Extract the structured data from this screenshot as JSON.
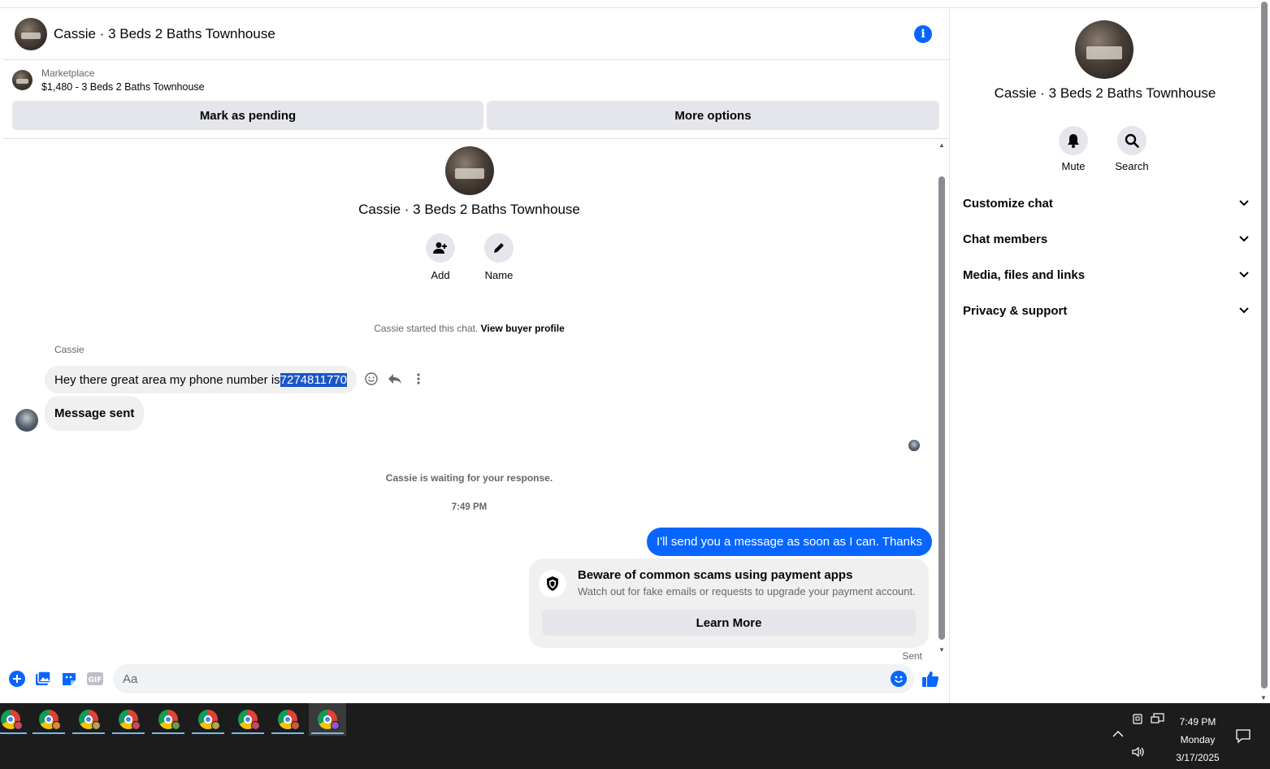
{
  "header": {
    "title": "Cassie · 3 Beds 2 Baths Townhouse",
    "info_icon": "info-icon"
  },
  "marketplace": {
    "label": "Marketplace",
    "listing": "$1,480 - 3 Beds 2 Baths Townhouse",
    "mark_pending": "Mark as pending",
    "more_options": "More options"
  },
  "conversation": {
    "name": "Cassie · 3 Beds 2 Baths Townhouse",
    "add_label": "Add",
    "name_label": "Name",
    "started_text": "Cassie started this chat.",
    "buyer_profile_link": "View buyer profile",
    "sender": "Cassie",
    "msg1_prefix": "Hey there great area my phone number is ",
    "msg1_number": "7274811770",
    "msg2": "Message sent",
    "waiting_text": "Cassie is waiting for your response.",
    "timestamp": "7:49 PM",
    "outgoing": "I'll send you a message as soon as I can. Thanks",
    "scam_title": "Beware of common scams using payment apps",
    "scam_sub": "Watch out for fake emails or requests to upgrade your payment account.",
    "learn_more": "Learn More",
    "sent_status": "Sent"
  },
  "composer": {
    "placeholder": "Aa"
  },
  "sidebar": {
    "name": "Cassie · 3 Beds 2 Baths Townhouse",
    "mute": "Mute",
    "search": "Search",
    "sections": [
      "Customize chat",
      "Chat members",
      "Media, files and links",
      "Privacy & support"
    ]
  },
  "taskbar": {
    "time": "7:49 PM",
    "day": "Monday",
    "date": "3/17/2025"
  },
  "colors": {
    "accent": "#0866ff",
    "bubble_in": "#f0f0f0",
    "taskbar": "#1c1c1c"
  }
}
